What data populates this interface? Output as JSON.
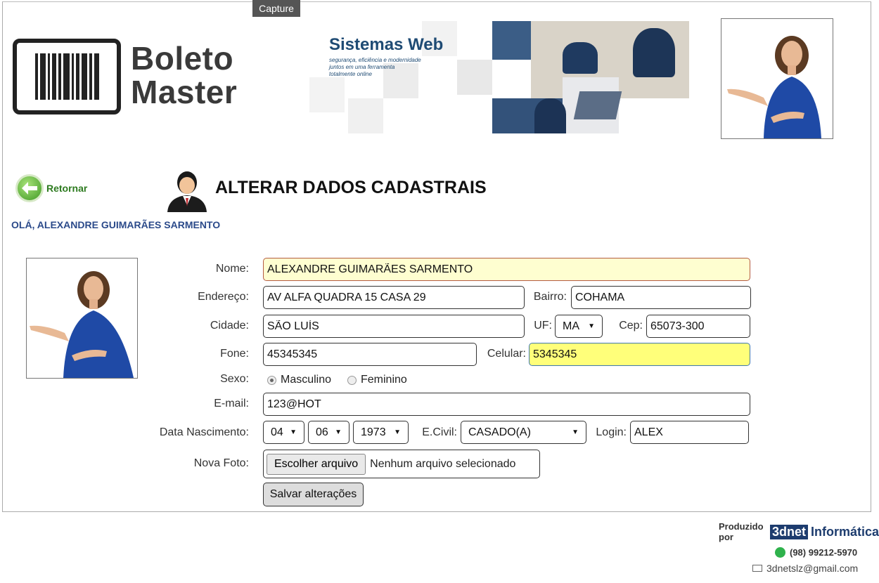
{
  "capture_label": "Capture",
  "logo": {
    "line1": "Boleto",
    "line2": "Master"
  },
  "banner": {
    "title": "Sistemas Web",
    "tagline_1": "segurança, eficiência e modernidade",
    "tagline_2": "juntos em uma ferramenta",
    "tagline_3": "totalmente online"
  },
  "nav": {
    "back_label": "Retornar"
  },
  "page_title": "ALTERAR DADOS CADASTRAIS",
  "greeting": "OLÁ, ALEXANDRE GUIMARÃES SARMENTO",
  "form": {
    "labels": {
      "nome": "Nome:",
      "endereco": "Endereço:",
      "bairro": "Bairro:",
      "cidade": "Cidade:",
      "uf": "UF:",
      "cep": "Cep:",
      "fone": "Fone:",
      "celular": "Celular:",
      "sexo": "Sexo:",
      "email": "E-mail:",
      "nascimento": "Data Nascimento:",
      "ecivil": "E.Civil:",
      "login": "Login:",
      "foto": "Nova Foto:"
    },
    "values": {
      "nome": "ALEXANDRE GUIMARÃES SARMENTO",
      "endereco": "AV ALFA QUADRA 15 CASA 29",
      "bairro": "COHAMA",
      "cidade": "SÃO LUÍS",
      "uf": "MA",
      "cep": "65073-300",
      "fone": "45345345",
      "celular": "5345345",
      "email": "123@HOT",
      "dia": "04",
      "mes": "06",
      "ano": "1973",
      "ecivil": "CASADO(A)",
      "login": "ALEX"
    },
    "sexo_options": {
      "masculino": "Masculino",
      "feminino": "Feminino"
    },
    "file_button": "Escolher arquivo",
    "file_status": "Nenhum arquivo selecionado",
    "save_button": "Salvar alterações"
  },
  "footer": {
    "produced_by": "Produzido por",
    "brand_a": "3dnet",
    "brand_b": "Informática",
    "phone": "(98) 99212-5970",
    "email": "3dnetslz@gmail.com"
  },
  "colors": {
    "title_blue": "#1f4b74",
    "greeting_blue": "#2b4a8a",
    "highlight_yellow": "#ffff7a"
  }
}
